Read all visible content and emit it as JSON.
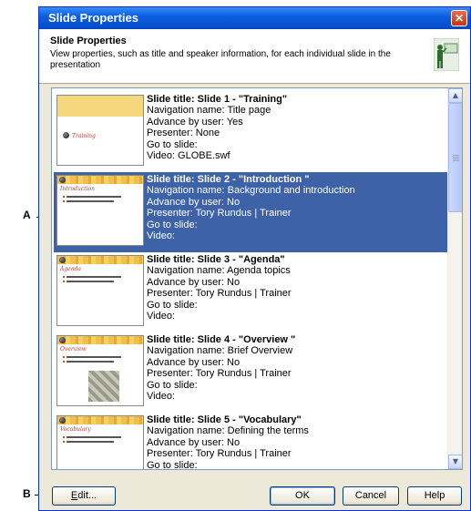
{
  "callouts": {
    "a": "A",
    "b": "B"
  },
  "dialog": {
    "title": "Slide Properties",
    "close_glyph": "✕",
    "header_title": "Slide Properties",
    "header_desc": "View properties, such as title and speaker information, for each individual slide in the presentation",
    "header_icon": "presenter-icon"
  },
  "slides": [
    {
      "title": "Slide title: Slide 1 - \"Training\"",
      "nav": "Navigation name: Title page",
      "advance": "Advance by user: Yes",
      "presenter": "Presenter: None",
      "goto": "Go to slide:",
      "video": "Video: GLOBE.swf",
      "thumb_title": "Training",
      "selected": false
    },
    {
      "title": "Slide title: Slide 2 - \"Introduction \"",
      "nav": "Navigation name: Background and introduction",
      "advance": "Advance by user: No",
      "presenter": "Presenter: Tory Rundus | Trainer",
      "goto": "Go to slide:",
      "video": "Video:",
      "thumb_title": "Introduction",
      "selected": true
    },
    {
      "title": "Slide title: Slide 3 - \"Agenda\"",
      "nav": "Navigation name: Agenda topics",
      "advance": "Advance by user: No",
      "presenter": "Presenter: Tory Rundus | Trainer",
      "goto": "Go to slide:",
      "video": "Video:",
      "thumb_title": "Agenda",
      "selected": false
    },
    {
      "title": "Slide title: Slide 4 - \"Overview \"",
      "nav": "Navigation name: Brief Overview",
      "advance": "Advance by user: No",
      "presenter": "Presenter: Tory Rundus | Trainer",
      "goto": "Go to slide:",
      "video": "Video:",
      "thumb_title": "Overview",
      "selected": false
    },
    {
      "title": "Slide title: Slide 5 - \"Vocabulary\"",
      "nav": "Navigation name: Defining the terms",
      "advance": "Advance by user: No",
      "presenter": "Presenter: Tory Rundus | Trainer",
      "goto": "Go to slide:",
      "video": "",
      "thumb_title": "Vocabulary",
      "selected": false
    }
  ],
  "buttons": {
    "edit_prefix": "E",
    "edit_rest": "dit...",
    "ok": "OK",
    "cancel": "Cancel",
    "help": "Help"
  },
  "colors": {
    "selection": "#3e62a8",
    "titlebar": "#0a5fe0"
  }
}
